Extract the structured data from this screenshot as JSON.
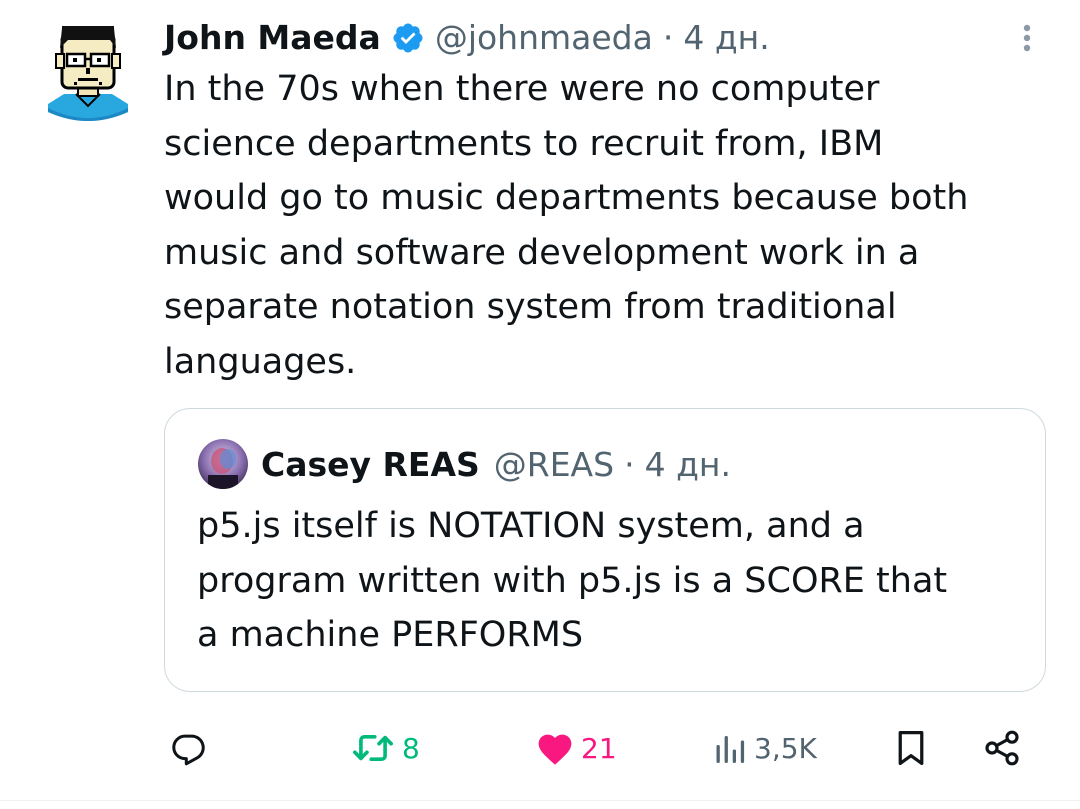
{
  "tweet": {
    "author": {
      "name": "John Maeda",
      "handle": "@johnmaeda",
      "time": "4 дн.",
      "separator": "·",
      "verified": true
    },
    "text": "In the 70s when there were no computer\nscience departments to recruit from, IBM\nwould go to music departments because both\nmusic and software development work in a\nseparate notation system from traditional\nlanguages."
  },
  "quote": {
    "author": {
      "name": "Casey REAS",
      "handle": "@REAS",
      "time": "4 дн.",
      "separator": "·"
    },
    "text": "p5.js itself is NOTATION system, and a\nprogram written with p5.js is a SCORE that\na machine PERFORMS"
  },
  "actions": {
    "retweet_count": "8",
    "like_count": "21",
    "views_count": "3,5K",
    "liked": true
  },
  "icons": {
    "verified": "verified-badge-icon",
    "more": "more-vertical-icon",
    "reply": "reply-icon",
    "retweet": "retweet-icon",
    "like": "heart-icon",
    "views": "views-icon",
    "bookmark": "bookmark-icon",
    "share": "share-icon"
  },
  "colors": {
    "text": "#0f1419",
    "secondary": "#536471",
    "verified": "#1d9bf0",
    "retweet": "#00ba7c",
    "like": "#f91880",
    "border": "#cfd9de"
  }
}
